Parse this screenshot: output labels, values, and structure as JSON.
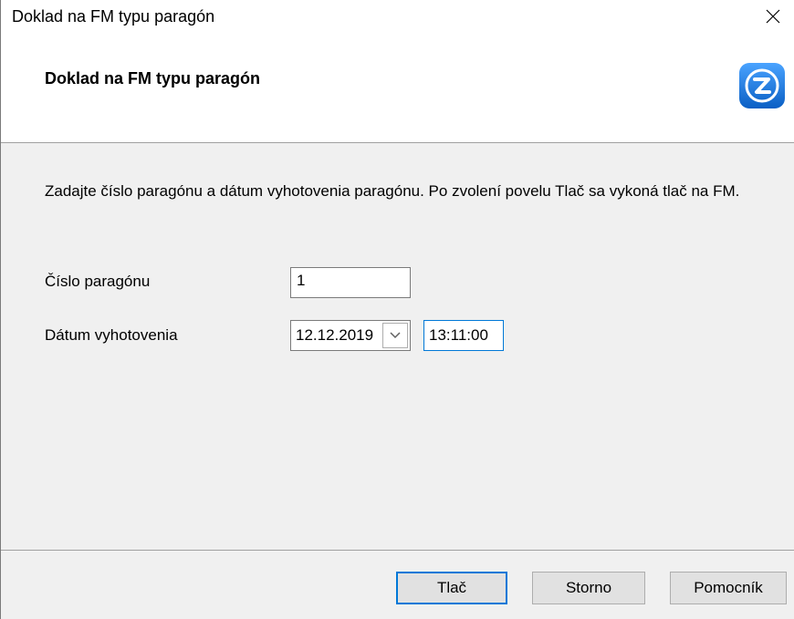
{
  "window": {
    "title": "Doklad na FM typu paragón"
  },
  "header": {
    "heading": "Doklad na FM typu paragón"
  },
  "content": {
    "instruction": "Zadajte číslo paragónu a dátum vyhotovenia paragónu. Po zvolení povelu Tlač sa vykoná tlač na FM.",
    "cislo_label": "Číslo paragónu",
    "cislo_value": "1",
    "datum_label": "Dátum vyhotovenia",
    "datum_value": "12.12.2019",
    "cas_value": "13:11:00"
  },
  "buttons": {
    "tlac": "Tlač",
    "storno": "Storno",
    "pomocnik": "Pomocník"
  },
  "colors": {
    "accent": "#0078d7",
    "logo": "#1a73d9"
  },
  "icons": {
    "close": "close-icon",
    "logo": "app-logo-icon",
    "dropdown": "chevron-down-icon"
  }
}
